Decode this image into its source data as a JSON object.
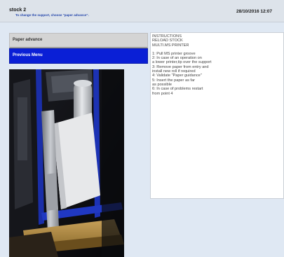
{
  "header": {
    "title": "stock 2",
    "subtitle": "To change the support, choose \"paper advance\".",
    "datetime": "28/10/2016 12:07"
  },
  "menu": {
    "items": [
      {
        "label": "Paper advance",
        "state": "normal"
      },
      {
        "label": "Previous Menu",
        "state": "selected"
      }
    ]
  },
  "instructions": {
    "heading_lines": [
      "INSTRUCTIONS",
      "RELOAD STOCK",
      "MULTI.MS PRINTER"
    ],
    "step_lines": [
      "1: Pull MS printer groove",
      "2: In case of an operation on",
      "a lower printer,tip over the support",
      "3: Remove paper from entry and",
      "install new roll if required",
      "4: Validate \"Paper guidance\"",
      "5: Insert the paper as far",
      "as possible",
      "6: In case of problems restart",
      "from point 4"
    ]
  },
  "photo": {
    "subject": "printer-mechanism-photo"
  },
  "colors": {
    "background": "#dfe8f3",
    "header_bg": "#dde3ea",
    "subtitle": "#2244aa",
    "button_normal": "#d4d4d4",
    "button_selected": "#0a1fd6"
  }
}
